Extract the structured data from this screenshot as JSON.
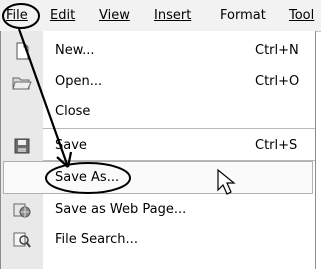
{
  "menubar": {
    "items": [
      {
        "label": "File",
        "underline_index": 0
      },
      {
        "label": "Edit",
        "underline_index": 0
      },
      {
        "label": "View",
        "underline_index": 0
      },
      {
        "label": "Insert",
        "underline_index": 0
      },
      {
        "label": "Format",
        "underline_index": 1
      },
      {
        "label": "Tool",
        "underline_index": 0
      }
    ]
  },
  "file_menu": {
    "items": [
      {
        "label": "New...",
        "mnemonic": "N",
        "accel": "Ctrl+N",
        "icon": "new-document-icon"
      },
      {
        "label": "Open...",
        "mnemonic": "O",
        "accel": "Ctrl+O",
        "icon": "open-folder-icon"
      },
      {
        "label": "Close",
        "mnemonic": "C",
        "accel": "",
        "icon": ""
      },
      {
        "label": "Save",
        "mnemonic": "S",
        "accel": "Ctrl+S",
        "icon": "save-disk-icon"
      },
      {
        "label": "Save As...",
        "mnemonic": "A",
        "accel": "",
        "icon": "",
        "highlighted": true
      },
      {
        "label": "Save as Web Page...",
        "mnemonic": "g",
        "accel": "",
        "icon": "web-page-icon"
      },
      {
        "label": "File Search...",
        "mnemonic": "h",
        "accel": "",
        "icon": "file-search-icon"
      }
    ]
  },
  "colors": {
    "menubar_bg": "#f2f2f2",
    "gutter_bg": "#e9e9e9",
    "annotation_ink": "#000000"
  }
}
